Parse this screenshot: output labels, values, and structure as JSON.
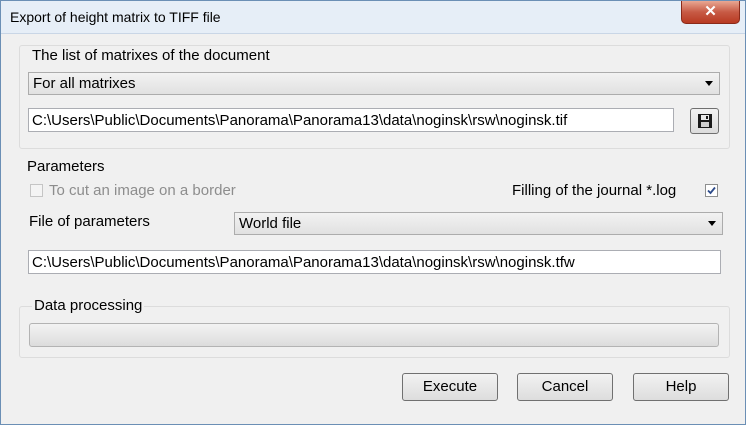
{
  "window": {
    "title": "Export of height matrix to TIFF file",
    "close_glyph": "✕"
  },
  "matrixes": {
    "heading": "The list of matrixes of the document",
    "selected": "For all matrixes",
    "output_path": "C:\\Users\\Public\\Documents\\Panorama\\Panorama13\\data\\noginsk\\rsw\\noginsk.tif",
    "save_icon": "floppy-disk-icon"
  },
  "parameters": {
    "heading": "Parameters",
    "cut_label": "To cut an image on a border",
    "cut_checked": false,
    "cut_enabled": false,
    "journal_label": "Filling of the journal *.log",
    "journal_checked": true,
    "file_label": "File of parameters",
    "file_selected": "World file",
    "file_path": "C:\\Users\\Public\\Documents\\Panorama\\Panorama13\\data\\noginsk\\rsw\\noginsk.tfw"
  },
  "processing": {
    "heading": "Data processing",
    "progress": 0
  },
  "buttons": {
    "execute": "Execute",
    "cancel": "Cancel",
    "help": "Help"
  }
}
